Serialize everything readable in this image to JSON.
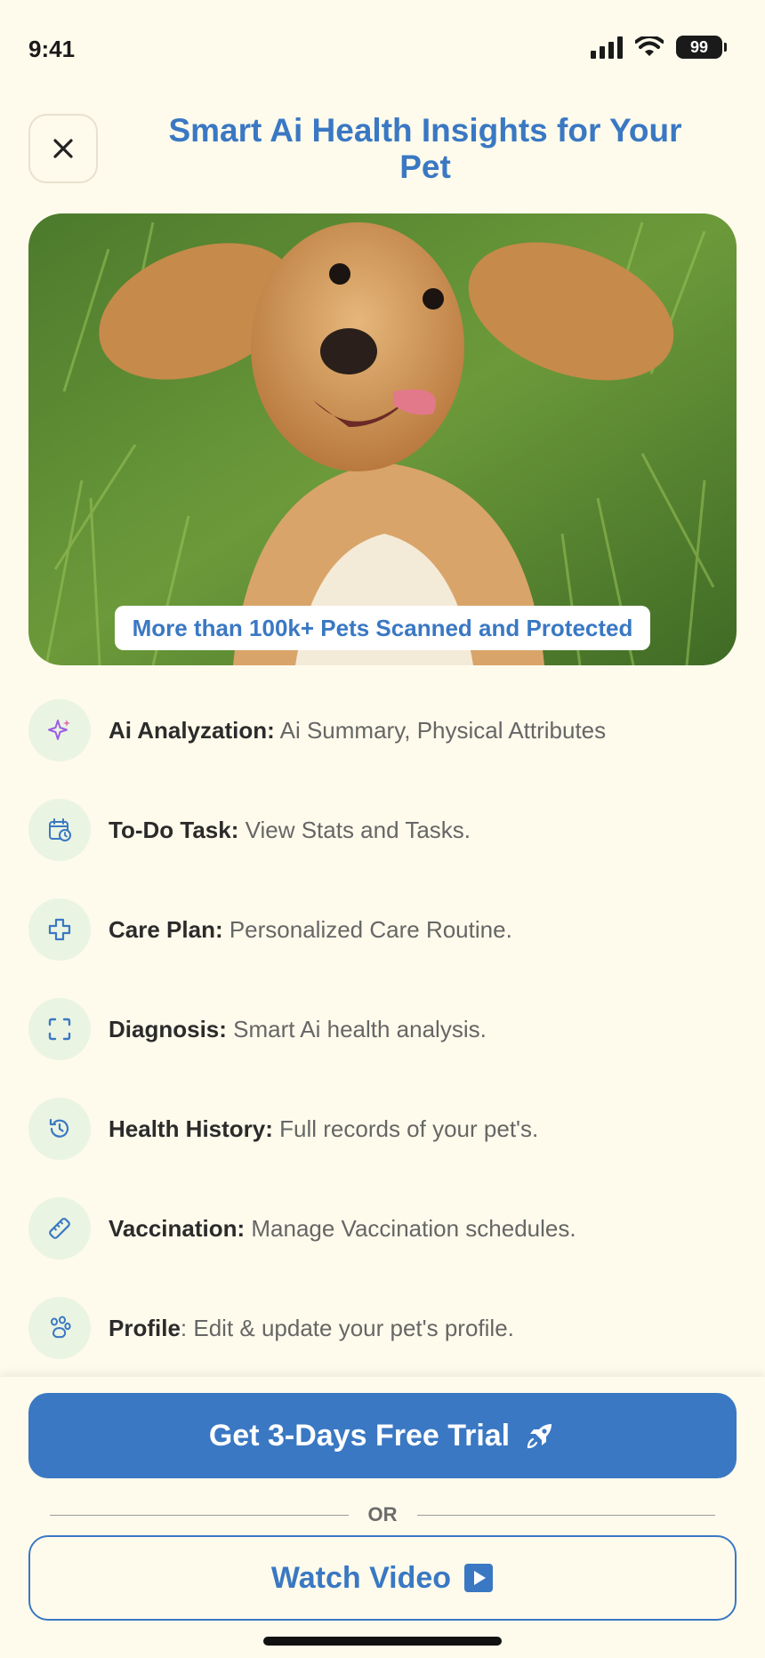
{
  "status_bar": {
    "time": "9:41",
    "battery": "99"
  },
  "header": {
    "title": "Smart Ai Health Insights for Your Pet",
    "close_icon": "close-icon"
  },
  "hero": {
    "badge": "More than 100k+ Pets Scanned and Protected"
  },
  "features": [
    {
      "title": "Ai Analyzation:",
      "description": " Ai Summary, Physical Attributes",
      "icon": "sparkle-icon"
    },
    {
      "title": "To-Do Task:",
      "description": " View Stats and Tasks.",
      "icon": "calendar-clock-icon"
    },
    {
      "title": "Care Plan:",
      "description": " Personalized Care Routine.",
      "icon": "medical-cross-icon"
    },
    {
      "title": "Diagnosis:",
      "description": " Smart Ai health analysis.",
      "icon": "scan-icon"
    },
    {
      "title": "Health History:",
      "description": " Full records of your pet's.",
      "icon": "history-icon"
    },
    {
      "title": "Vaccination:",
      "description": " Manage Vaccination schedules.",
      "icon": "syringe-icon"
    },
    {
      "title": "Profile",
      "description": ": Edit & update your pet's profile.",
      "icon": "paw-icon"
    }
  ],
  "actions": {
    "trial_label": "Get 3-Days Free Trial",
    "or_label": "OR",
    "video_label": "Watch Video"
  },
  "colors": {
    "accent": "#3a78c3",
    "background": "#fffbec",
    "icon_bg": "#eaf4e3"
  }
}
